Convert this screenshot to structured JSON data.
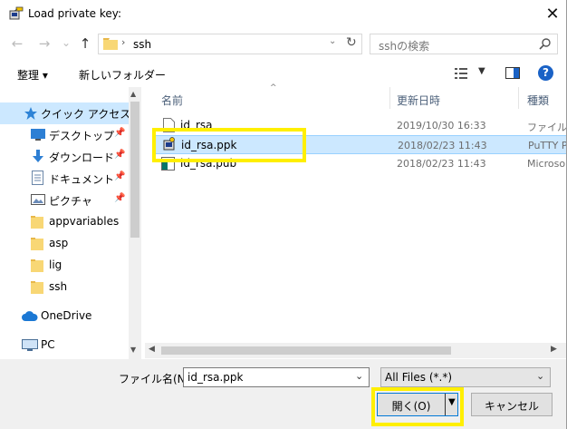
{
  "window": {
    "title": "Load private key:",
    "close_icon": "close-icon"
  },
  "nav": {
    "back_icon": "←",
    "forward_icon": "→",
    "recent_icon": "⌄",
    "up_icon": "↑",
    "path_chevron": "›",
    "path": "ssh",
    "refresh_icon": "↻",
    "search_placeholder": "sshの検索"
  },
  "toolbar": {
    "organize_label": "整理 ▾",
    "new_folder_label": "新しいフォルダー"
  },
  "sidebar": {
    "items": [
      {
        "label": "クイック アクセス",
        "icon": "star-icon",
        "selected": true
      },
      {
        "label": "デスクトップ",
        "icon": "desktop-icon",
        "pinned": true
      },
      {
        "label": "ダウンロード",
        "icon": "download-icon",
        "pinned": true
      },
      {
        "label": "ドキュメント",
        "icon": "document-icon",
        "pinned": true
      },
      {
        "label": "ピクチャ",
        "icon": "pictures-icon",
        "pinned": true
      },
      {
        "label": "appvariables",
        "icon": "folder-icon"
      },
      {
        "label": "asp",
        "icon": "folder-icon"
      },
      {
        "label": "lig",
        "icon": "folder-icon"
      },
      {
        "label": "ssh",
        "icon": "folder-icon"
      },
      {
        "label": "OneDrive",
        "icon": "cloud-icon"
      },
      {
        "label": "PC",
        "icon": "computer-icon"
      }
    ]
  },
  "file_list": {
    "columns": [
      "名前",
      "更新日時",
      "種類"
    ],
    "rows": [
      {
        "name": "id_rsa",
        "date": "2019/10/30 16:33",
        "type": "ファイル",
        "icon": "file-icon",
        "selected": false
      },
      {
        "name": "id_rsa.ppk",
        "date": "2018/02/23 11:43",
        "type": "PuTTY P",
        "icon": "putty-key-icon",
        "selected": true
      },
      {
        "name": "id_rsa.pub",
        "date": "2018/02/23 11:43",
        "type": "Microso",
        "icon": "publisher-icon",
        "selected": false
      }
    ]
  },
  "bottom": {
    "filename_label": "ファイル名(N):",
    "filename_value": "id_rsa.ppk",
    "filetype_value": "All Files (*.*)",
    "open_label": "開く(O)",
    "cancel_label": "キャンセル"
  },
  "colors": {
    "highlight": "#ffef00",
    "selection": "#cce8ff",
    "accent": "#1a62c6"
  }
}
